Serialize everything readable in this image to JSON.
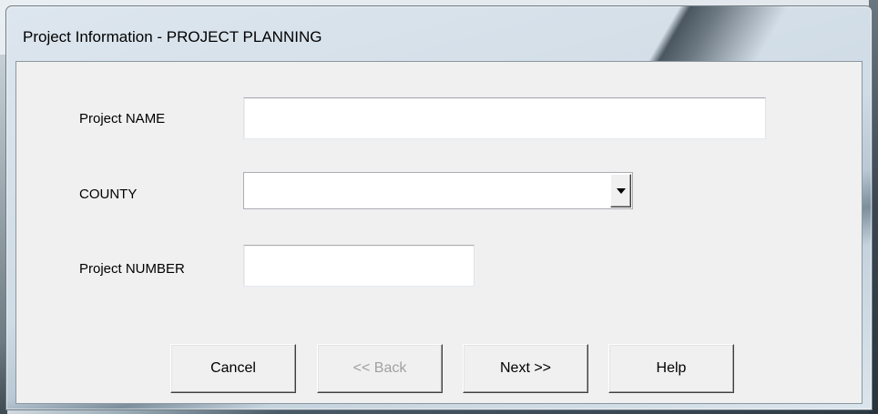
{
  "window": {
    "title": "Project Information - PROJECT PLANNING"
  },
  "form": {
    "project_name": {
      "label": "Project NAME",
      "value": ""
    },
    "county": {
      "label": "COUNTY",
      "value": ""
    },
    "project_number": {
      "label": "Project NUMBER",
      "value": ""
    }
  },
  "buttons": {
    "cancel": "Cancel",
    "back": "<< Back",
    "next": "Next >>",
    "help": "Help"
  },
  "icons": {
    "dropdown": "chevron-down-icon"
  }
}
